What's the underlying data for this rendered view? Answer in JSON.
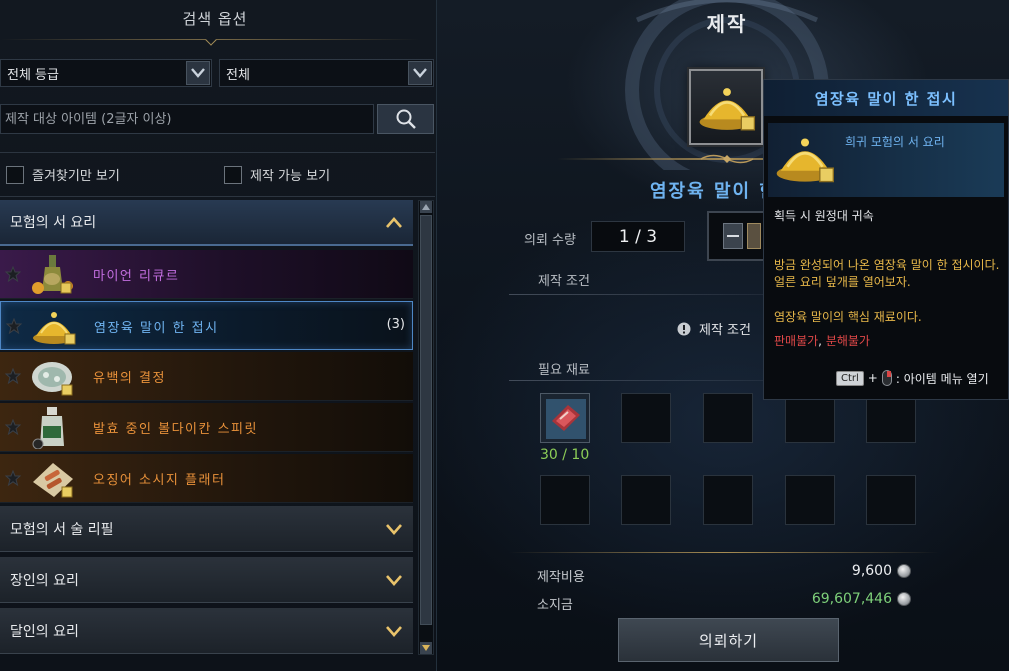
{
  "left_panel": {
    "title": "검색 옵션",
    "grade_select": "전체 등급",
    "category_select": "전체",
    "search_placeholder": "제작 대상 아이템 (2글자 이상)",
    "favorites_only": "즐겨찾기만 보기",
    "craftable_only": "제작 가능 보기",
    "categories": [
      {
        "label": "모험의 서 요리",
        "expanded": true
      },
      {
        "label": "모험의 서 술 리필",
        "expanded": false
      },
      {
        "label": "장인의 요리",
        "expanded": false
      },
      {
        "label": "달인의 요리",
        "expanded": false
      }
    ],
    "recipes": [
      {
        "name": "마이언 리큐르",
        "color": "#c36ee0",
        "count": ""
      },
      {
        "name": "염장육 말이 한 접시",
        "color": "#6fb3f0",
        "count": "(3)"
      },
      {
        "name": "유백의 결정",
        "color": "#e8913a",
        "count": ""
      },
      {
        "name": "발효 중인 볼다이칸 스피릿",
        "color": "#e8913a",
        "count": ""
      },
      {
        "name": "오징어 소시지 플래터",
        "color": "#e8913a",
        "count": ""
      }
    ]
  },
  "craft": {
    "title": "제작",
    "item_name": "염장육 말이 한",
    "request_qty_label": "의뢰 수량",
    "request_qty_value": "1 / 3",
    "conditions_label": "제작 조건",
    "conditions_notice": "제작 조건",
    "materials_label": "필요 재료",
    "material_count": "30 / 10",
    "cost_label": "제작비용",
    "cost_value": "9,600",
    "owned_label": "소지금",
    "owned_value": "69,607,446",
    "owned_color": "#7ed07a",
    "request_button": "의뢰하기"
  },
  "tooltip": {
    "title": "염장육 말이 한 접시",
    "grade": "희귀 모험의 서 요리",
    "bind": "획득 시 원정대 귀속",
    "desc_line1": "방금 완성되어 나온 염장육 말이 한 접시이다.",
    "desc_line2": "얼른 요리 덮개를 열어보자.",
    "note": "염장육 말이의 핵심 재료이다.",
    "no_sell": "판매불가",
    "sep": ", ",
    "no_disassemble": "분해불가",
    "key_ctrl": "Ctrl",
    "key_plus": "+",
    "key_hint": ": 아이템 메뉴 열기"
  },
  "colors": {
    "rare": "#6fb3f0",
    "epic": "#c36ee0",
    "legendary": "#e8913a",
    "warn": "#e04848",
    "note": "#e8b84a"
  }
}
